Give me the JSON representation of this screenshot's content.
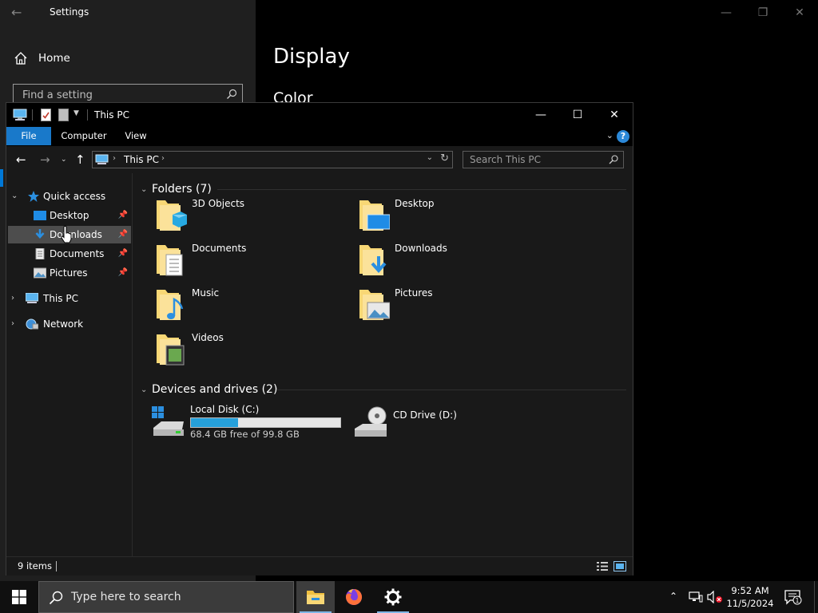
{
  "settings": {
    "title": "Settings",
    "home_label": "Home",
    "search_placeholder": "Find a setting",
    "page_title": "Display",
    "section_title": "Color"
  },
  "explorer": {
    "title": "This PC",
    "ribbon_tabs": [
      "File",
      "Computer",
      "View"
    ],
    "address": "This PC",
    "search_placeholder": "Search This PC",
    "nav_tree": [
      {
        "label": "Quick access",
        "pinned": false
      },
      {
        "label": "Desktop",
        "pinned": true
      },
      {
        "label": "Downloads",
        "pinned": true
      },
      {
        "label": "Documents",
        "pinned": true
      },
      {
        "label": "Pictures",
        "pinned": true
      },
      {
        "label": "This PC",
        "pinned": false
      },
      {
        "label": "Network",
        "pinned": false
      }
    ],
    "folders_header": "Folders (7)",
    "folders": [
      "3D Objects",
      "Desktop",
      "Documents",
      "Downloads",
      "Music",
      "Pictures",
      "Videos"
    ],
    "devices_header": "Devices and drives (2)",
    "drives": [
      {
        "name": "Local Disk (C:)",
        "free_text": "68.4 GB free of 99.8 GB",
        "used_fraction": 0.315
      },
      {
        "name": "CD Drive (D:)"
      }
    ],
    "status_count": "9 items"
  },
  "taskbar": {
    "search_placeholder": "Type here to search",
    "time": "9:52 AM",
    "date": "11/5/2024",
    "notification_count": "1"
  },
  "colors": {
    "accent": "#0078d7",
    "file_tab": "#1979ca",
    "drive_bar_fill": "#26a0da",
    "folder_yellow": "#f8d775"
  }
}
